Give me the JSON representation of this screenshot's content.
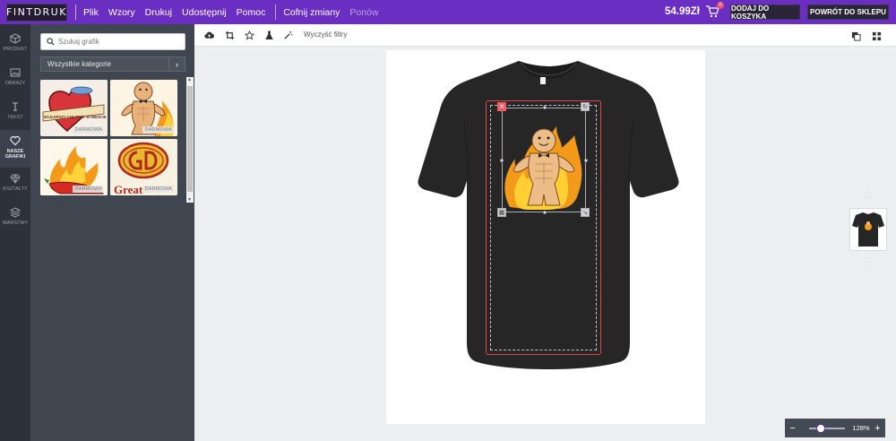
{
  "brand": {
    "logo_text": "FINTDRUK"
  },
  "menu": [
    {
      "label": "Plik"
    },
    {
      "label": "Wzory"
    },
    {
      "label": "Drukuj"
    },
    {
      "label": "Udostępnij"
    },
    {
      "label": "Pomoc"
    }
  ],
  "history": {
    "undo_label": "Cofnij zmiany",
    "redo_label": "Ponów"
  },
  "cart": {
    "price": "54.99Zł",
    "badge_count": "0",
    "add_to_cart_label": "DODAJ DO KOSZYKA",
    "back_to_shop_label": "POWRÓT DO SKLEPU"
  },
  "rail": [
    {
      "label": "PRODUKT",
      "icon": "cube-icon"
    },
    {
      "label": "OBRAZY",
      "icon": "image-icon"
    },
    {
      "label": "TEKST",
      "icon": "text-icon"
    },
    {
      "label": "NASZE GRAFIKI",
      "icon": "heart-icon",
      "active": true
    },
    {
      "label": "KSZTAŁTY",
      "icon": "diamond-icon"
    },
    {
      "label": "WARSTWY",
      "icon": "layers-icon"
    }
  ],
  "panel": {
    "search_placeholder": "Szukaj grafik",
    "category_label": "Wszystkie kategorie",
    "thumbs": [
      {
        "badge": "DARMOWA",
        "banner_text": "NAJLEPSZY CHŁOPAK W MIEŚCIE"
      },
      {
        "badge": "DARMOWA"
      },
      {
        "badge": "DARMOWA"
      },
      {
        "badge": "DARMOWA",
        "text": "Great"
      }
    ]
  },
  "toolbar": {
    "clear_filters_label": "Wyczyść filtry"
  },
  "zoom": {
    "minus": "−",
    "plus": "+",
    "value": "128%",
    "level": 0.28
  },
  "colors": {
    "topbar": "#6a2fc2",
    "rail": "#2c313a",
    "panel": "#3f4650",
    "shirt": "#262626",
    "accent_red": "#e0444d"
  }
}
